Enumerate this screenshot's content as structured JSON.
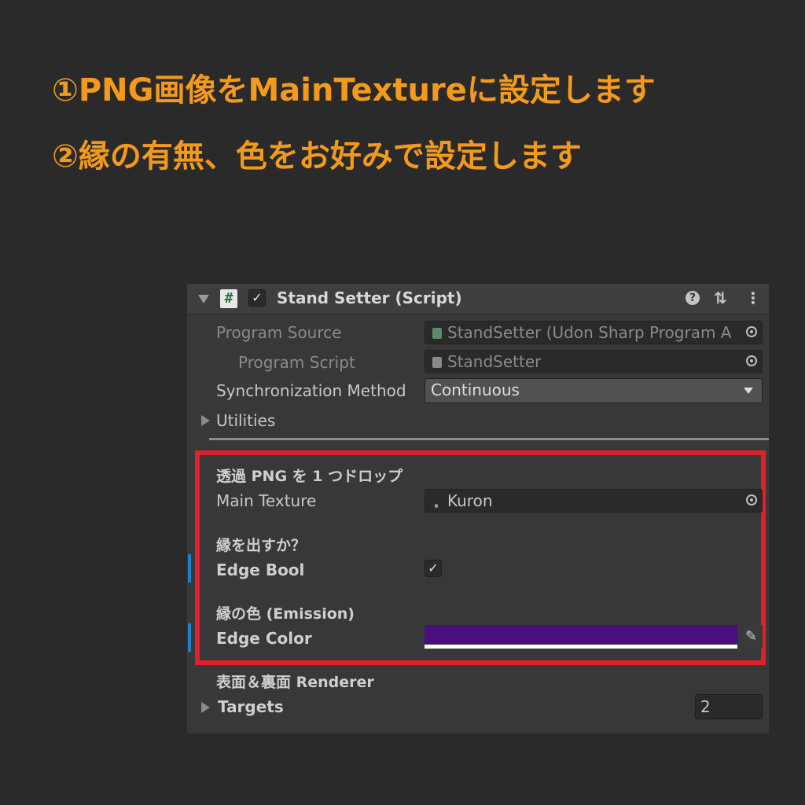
{
  "headline": {
    "line1": "①PNG画像をMainTextureに設定します",
    "line2": "②縁の有無、色をお好みで設定します"
  },
  "colors": {
    "headline": "#f39a1c",
    "highlight_border": "#e0202a",
    "edge_color": "#4b0e7e",
    "modified_marker": "#1c82d0"
  },
  "component": {
    "icon_glyph": "#",
    "enabled_check": "✓",
    "title": "Stand Setter (Script)",
    "help_glyph": "?",
    "settings_glyph": "⇅",
    "menu_glyph": "⋮"
  },
  "fields": {
    "program_source": {
      "label": "Program Source",
      "value": "StandSetter (Udon Sharp Program A"
    },
    "program_script": {
      "label": "Program Script",
      "value": "StandSetter"
    },
    "sync_method": {
      "label": "Synchronization Method",
      "value": "Continuous"
    },
    "utilities": {
      "label": "Utilities"
    }
  },
  "custom": {
    "png_header": "透過 PNG を 1 つドロップ",
    "main_texture": {
      "label": "Main Texture",
      "value": "Kuron"
    },
    "edge_header": "縁を出すか？",
    "edge_bool": {
      "label": "Edge Bool",
      "check": "✓"
    },
    "color_header": "縁の色 (Emission)",
    "edge_color": {
      "label": "Edge Color",
      "eyedropper_glyph": "✎"
    }
  },
  "renderer": {
    "header": "表面＆裏面 Renderer",
    "targets": {
      "label": "Targets",
      "count": "2"
    }
  }
}
